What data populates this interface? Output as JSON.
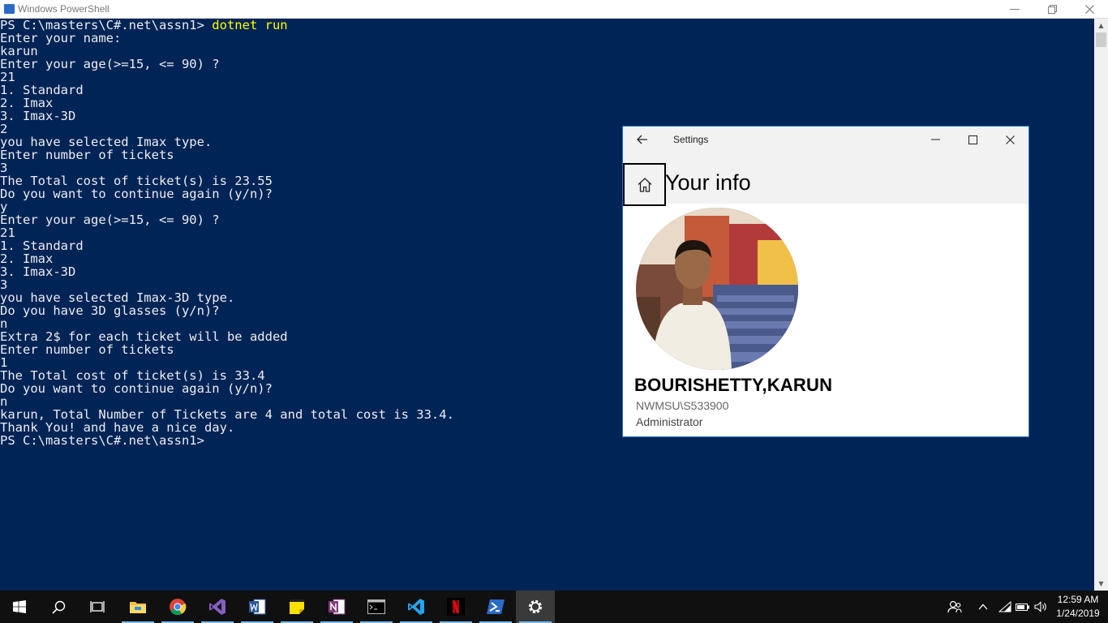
{
  "powershell": {
    "window_title": "Windows PowerShell",
    "lines": [
      {
        "prompt": "PS C:\\masters\\C#.net\\assn1> ",
        "cmd": "dotnet run"
      },
      {
        "text": "Enter your name:"
      },
      {
        "text": "karun"
      },
      {
        "text": "Enter your age(>=15, <= 90) ?"
      },
      {
        "text": "21"
      },
      {
        "text": "1. Standard"
      },
      {
        "text": "2. Imax"
      },
      {
        "text": "3. Imax-3D"
      },
      {
        "text": "2"
      },
      {
        "text": "you have selected Imax type."
      },
      {
        "text": "Enter number of tickets"
      },
      {
        "text": "3"
      },
      {
        "text": "The Total cost of ticket(s) is 23.55"
      },
      {
        "text": "Do you want to continue again (y/n)?"
      },
      {
        "text": "y"
      },
      {
        "text": "Enter your age(>=15, <= 90) ?"
      },
      {
        "text": "21"
      },
      {
        "text": "1. Standard"
      },
      {
        "text": "2. Imax"
      },
      {
        "text": "3. Imax-3D"
      },
      {
        "text": "3"
      },
      {
        "text": "you have selected Imax-3D type."
      },
      {
        "text": "Do you have 3D glasses (y/n)?"
      },
      {
        "text": "n"
      },
      {
        "text": "Extra 2$ for each ticket will be added"
      },
      {
        "text": "Enter number of tickets"
      },
      {
        "text": "1"
      },
      {
        "text": "The Total cost of ticket(s) is 33.4"
      },
      {
        "text": "Do you want to continue again (y/n)?"
      },
      {
        "text": "n"
      },
      {
        "text": "karun, Total Number of Tickets are 4 and total cost is 33.4."
      },
      {
        "text": "Thank You! and have a nice day."
      },
      {
        "text": "PS C:\\masters\\C#.net\\assn1>"
      }
    ],
    "colors": {
      "background": "#012456",
      "foreground": "#eeedf0",
      "command": "#ffff00"
    }
  },
  "settings": {
    "window_title": "Settings",
    "heading": "Your info",
    "display_name": "BOURISHETTY,KARUN",
    "account_id": "NWMSU\\S533900",
    "account_role": "Administrator",
    "accent": "#1a73c6"
  },
  "taskbar": {
    "apps": [
      {
        "name": "start",
        "icon": "windows-logo-icon"
      },
      {
        "name": "search",
        "icon": "search-icon"
      },
      {
        "name": "task-view",
        "icon": "task-view-icon"
      },
      {
        "name": "file-explorer",
        "icon": "folder-icon"
      },
      {
        "name": "chrome",
        "icon": "chrome-icon"
      },
      {
        "name": "visual-studio",
        "icon": "visual-studio-icon"
      },
      {
        "name": "word",
        "icon": "word-icon"
      },
      {
        "name": "sticky-notes",
        "icon": "sticky-notes-icon"
      },
      {
        "name": "onenote",
        "icon": "onenote-icon"
      },
      {
        "name": "command-prompt",
        "icon": "terminal-icon"
      },
      {
        "name": "vs-code",
        "icon": "vscode-icon"
      },
      {
        "name": "netflix",
        "icon": "netflix-icon"
      },
      {
        "name": "powershell",
        "icon": "powershell-icon"
      },
      {
        "name": "settings",
        "icon": "gear-icon"
      }
    ],
    "clock_time": "12:59 AM",
    "clock_date": "1/24/2019"
  }
}
